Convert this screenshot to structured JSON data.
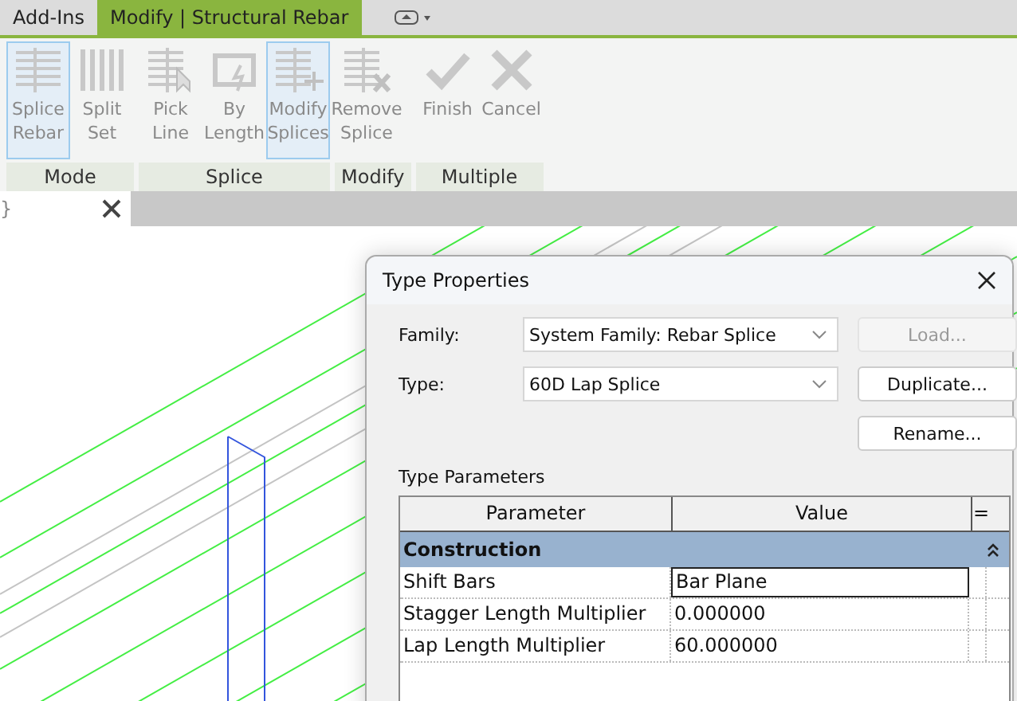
{
  "ribbon_tabs": [
    {
      "label": "Add-Ins",
      "selected": false
    },
    {
      "label": "Modify | Structural Rebar",
      "selected": true
    }
  ],
  "panels": [
    {
      "label": "Mode",
      "tools": [
        {
          "label": "Splice Rebar",
          "kind": "splice",
          "selected": true
        },
        {
          "label": "Split Set",
          "kind": "split",
          "selected": false
        }
      ]
    },
    {
      "label": "Splice",
      "tools": [
        {
          "label": "Pick Line",
          "kind": "pick",
          "selected": false
        },
        {
          "label": "By Length",
          "kind": "length",
          "selected": false
        },
        {
          "label": "Modify Splices",
          "kind": "modify",
          "selected": true
        }
      ]
    },
    {
      "label": "Modify",
      "tools": [
        {
          "label": "Remove Splice",
          "kind": "remove",
          "selected": false
        }
      ]
    },
    {
      "label": "Multiple",
      "tools": [
        {
          "label": "Finish",
          "kind": "finish",
          "selected": false
        },
        {
          "label": "Cancel",
          "kind": "cancel",
          "selected": false
        }
      ]
    }
  ],
  "view_tab": {
    "label": "}"
  },
  "dialog": {
    "title": "Type Properties",
    "fields": [
      {
        "label": "Family:",
        "value": "System Family: Rebar Splice"
      },
      {
        "label": "Type:",
        "value": "60D Lap Splice"
      }
    ],
    "buttons": [
      {
        "label": "Load...",
        "disabled": true
      },
      {
        "label": "Duplicate...",
        "disabled": false
      },
      {
        "label": "Rename...",
        "disabled": false
      }
    ],
    "section": "Type Parameters",
    "table": {
      "columns": [
        "Parameter",
        "Value",
        "="
      ],
      "group": {
        "label": "Construction",
        "expanded": true
      },
      "rows": [
        {
          "parameter": "Shift Bars",
          "value": "Bar Plane",
          "selected": true
        },
        {
          "parameter": "Stagger Length Multiplier",
          "value": "0.000000",
          "selected": false
        },
        {
          "parameter": "Lap Length Multiplier",
          "value": "60.000000",
          "selected": false
        }
      ]
    }
  }
}
